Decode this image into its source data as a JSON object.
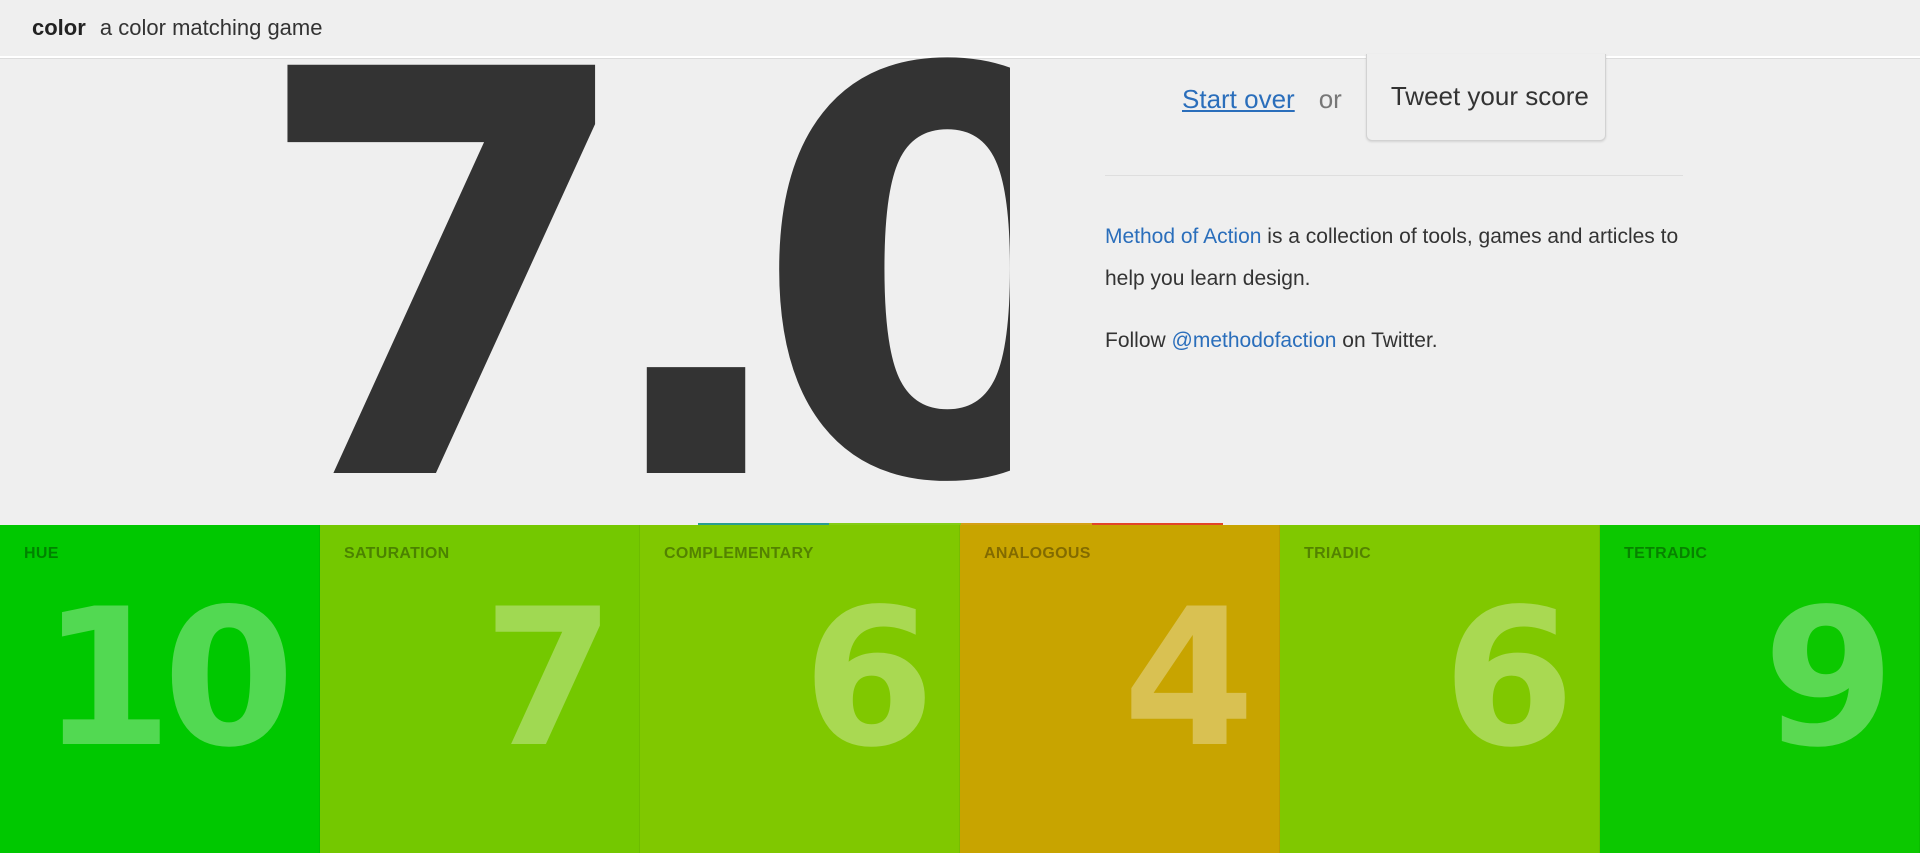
{
  "header": {
    "logo": "color",
    "tagline": "a color matching game"
  },
  "score": {
    "value": "7.0"
  },
  "actions": {
    "start_over": "Start over",
    "or": "or",
    "tweet": "Tweet your score"
  },
  "info": {
    "method_link": "Method of Action",
    "description": " is a collection of tools, games and articles to help you learn design.",
    "follow_prefix": "Follow ",
    "twitter_handle": "@methodofaction",
    "follow_suffix": " on Twitter."
  },
  "accent_colors": [
    "#2a9d8f",
    "#84cc16",
    "#d4a017",
    "#e2452a"
  ],
  "categories": [
    {
      "label": "HUE",
      "score": "10",
      "color": "#00c800"
    },
    {
      "label": "SATURATION",
      "score": "7",
      "color": "#74c800"
    },
    {
      "label": "COMPLEMENTARY",
      "score": "6",
      "color": "#80c800"
    },
    {
      "label": "ANALOGOUS",
      "score": "4",
      "color": "#c8a400"
    },
    {
      "label": "TRIADIC",
      "score": "6",
      "color": "#80c800"
    },
    {
      "label": "TETRADIC",
      "score": "9",
      "color": "#0cc800"
    }
  ]
}
